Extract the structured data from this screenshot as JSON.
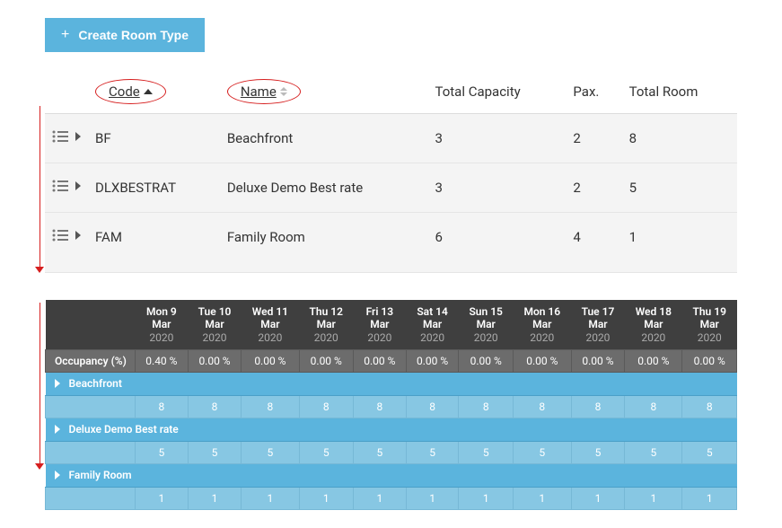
{
  "create_button": "Create Room Type",
  "room_headers": {
    "code": "Code",
    "name": "Name",
    "capacity": "Total Capacity",
    "pax": "Pax.",
    "total_room": "Total Room"
  },
  "rooms": [
    {
      "code": "BF",
      "name": "Beachfront",
      "capacity": "3",
      "pax": "2",
      "total_room": "8"
    },
    {
      "code": "DLXBESTRAT",
      "name": "Deluxe Demo Best rate",
      "capacity": "3",
      "pax": "2",
      "total_room": "5"
    },
    {
      "code": "FAM",
      "name": "Family Room",
      "capacity": "6",
      "pax": "4",
      "total_room": "1"
    }
  ],
  "calendar": {
    "dates": [
      {
        "d": "Mon 9 Mar",
        "y": "2020"
      },
      {
        "d": "Tue 10 Mar",
        "y": "2020"
      },
      {
        "d": "Wed 11 Mar",
        "y": "2020"
      },
      {
        "d": "Thu 12 Mar",
        "y": "2020"
      },
      {
        "d": "Fri 13 Mar",
        "y": "2020"
      },
      {
        "d": "Sat 14 Mar",
        "y": "2020"
      },
      {
        "d": "Sun 15 Mar",
        "y": "2020"
      },
      {
        "d": "Mon 16 Mar",
        "y": "2020"
      },
      {
        "d": "Tue 17 Mar",
        "y": "2020"
      },
      {
        "d": "Wed 18 Mar",
        "y": "2020"
      },
      {
        "d": "Thu 19 Mar",
        "y": "2020"
      }
    ],
    "occupancy_label": "Occupancy (%)",
    "occupancy": [
      "0.40 %",
      "0.00 %",
      "0.00 %",
      "0.00 %",
      "0.00 %",
      "0.00 %",
      "0.00 %",
      "0.00 %",
      "0.00 %",
      "0.00 %",
      "0.00 %"
    ],
    "groups": [
      {
        "name": "Beachfront",
        "values": [
          "8",
          "8",
          "8",
          "8",
          "8",
          "8",
          "8",
          "8",
          "8",
          "8",
          "8"
        ]
      },
      {
        "name": "Deluxe Demo Best rate",
        "values": [
          "5",
          "5",
          "5",
          "5",
          "5",
          "5",
          "5",
          "5",
          "5",
          "5",
          "5"
        ]
      },
      {
        "name": "Family Room",
        "values": [
          "1",
          "1",
          "1",
          "1",
          "1",
          "1",
          "1",
          "1",
          "1",
          "1",
          "1"
        ]
      }
    ]
  }
}
